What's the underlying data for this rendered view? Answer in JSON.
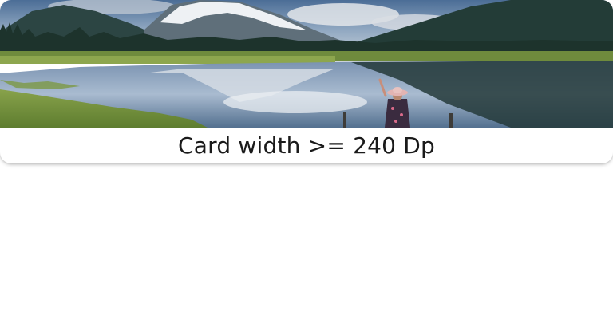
{
  "card": {
    "caption": "Card width >= 240 Dp",
    "image_subject": "mountain-lake-landscape",
    "colors": {
      "sky_top": "#4d6f97",
      "sky_bottom": "#c9d3dc",
      "mountain_dark": "#1f3a35",
      "snow": "#e8edf1",
      "grass": "#6f8d3e",
      "water": "#6f87a6"
    }
  }
}
